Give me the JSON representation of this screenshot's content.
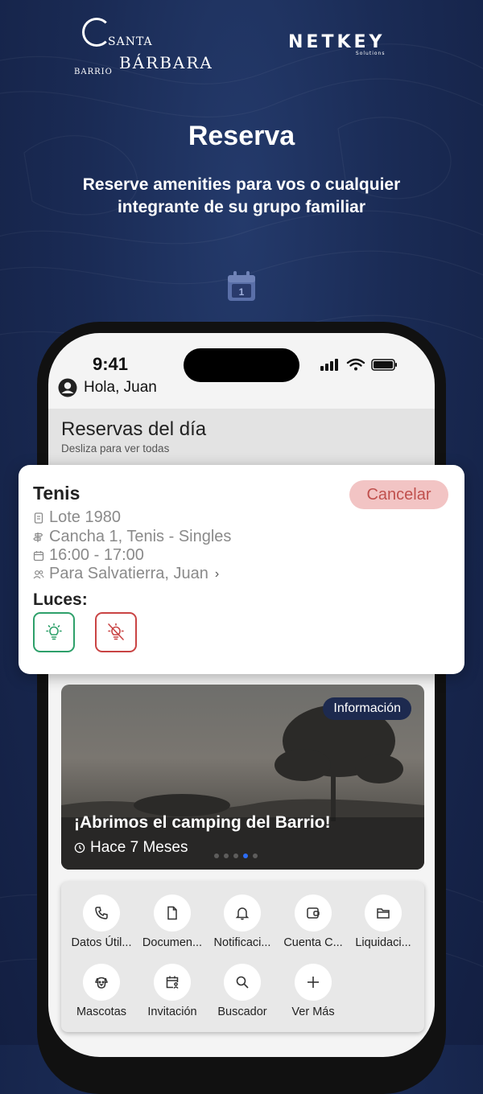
{
  "branding": {
    "left_top": "SANTA",
    "left_prefix": "BARRIO",
    "left_main": "BÁRBARA",
    "right_name": "NETKEY",
    "right_tag": "Solutions"
  },
  "hero": {
    "title": "Reserva",
    "subtitle": "Reserve amenities para vos o cualquier integrante de su grupo familiar",
    "icon": "calendar-icon",
    "calendar_day": "1"
  },
  "status_bar": {
    "time": "9:41"
  },
  "header": {
    "greeting": "Hola, Juan"
  },
  "reservations": {
    "title": "Reservas del día",
    "hint": "Desliza para ver todas"
  },
  "reservation_card": {
    "title": "Tenis",
    "cancel_label": "Cancelar",
    "lot": "Lote 1980",
    "court": "Cancha 1, Tenis - Singles",
    "time_range": "16:00 - 17:00",
    "for_whom": "Para Salvatierra, Juan",
    "lights_label": "Luces:"
  },
  "news": {
    "badge": "Información",
    "title": "¡Abrimos el camping del Barrio!",
    "time_ago": "Hace 7 Meses",
    "active_dot": 4,
    "dot_count": 5
  },
  "quick_menu": [
    {
      "label": "Datos Útil...",
      "icon": "phone-icon"
    },
    {
      "label": "Documen...",
      "icon": "document-icon"
    },
    {
      "label": "Notificaci...",
      "icon": "bell-icon"
    },
    {
      "label": "Cuenta C...",
      "icon": "wallet-icon"
    },
    {
      "label": "Liquidaci...",
      "icon": "folder-icon"
    },
    {
      "label": "Mascotas",
      "icon": "dog-icon"
    },
    {
      "label": "Invitación",
      "icon": "calendar-user-icon"
    },
    {
      "label": "Buscador",
      "icon": "search-icon"
    },
    {
      "label": "Ver Más",
      "icon": "plus-icon"
    }
  ],
  "colors": {
    "background": "#1a2b55",
    "cancel_bg": "#f2c4c4",
    "cancel_text": "#c0504d",
    "light_on": "#2ea06a",
    "light_off": "#c94444",
    "active_dot": "#2d6df6",
    "badge_bg": "#1d2a4f"
  }
}
